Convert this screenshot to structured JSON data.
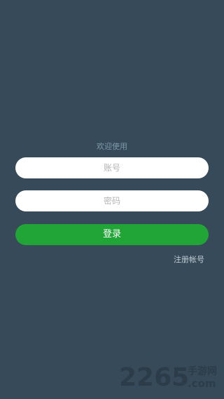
{
  "welcome_text": "欢迎使用",
  "account_field": {
    "placeholder": "账号",
    "value": ""
  },
  "password_field": {
    "placeholder": "密码",
    "value": ""
  },
  "login_button": {
    "label": "登录"
  },
  "register_link": {
    "label": "注册帐号"
  },
  "watermark": {
    "number": "2265",
    "cn": "手游网",
    "domain": ".com"
  },
  "colors": {
    "background": "#374a5a",
    "primary_button": "#20a536",
    "input_background": "#ffffff",
    "welcome_text": "#7b9bab",
    "link_text": "#c3cdd3"
  }
}
